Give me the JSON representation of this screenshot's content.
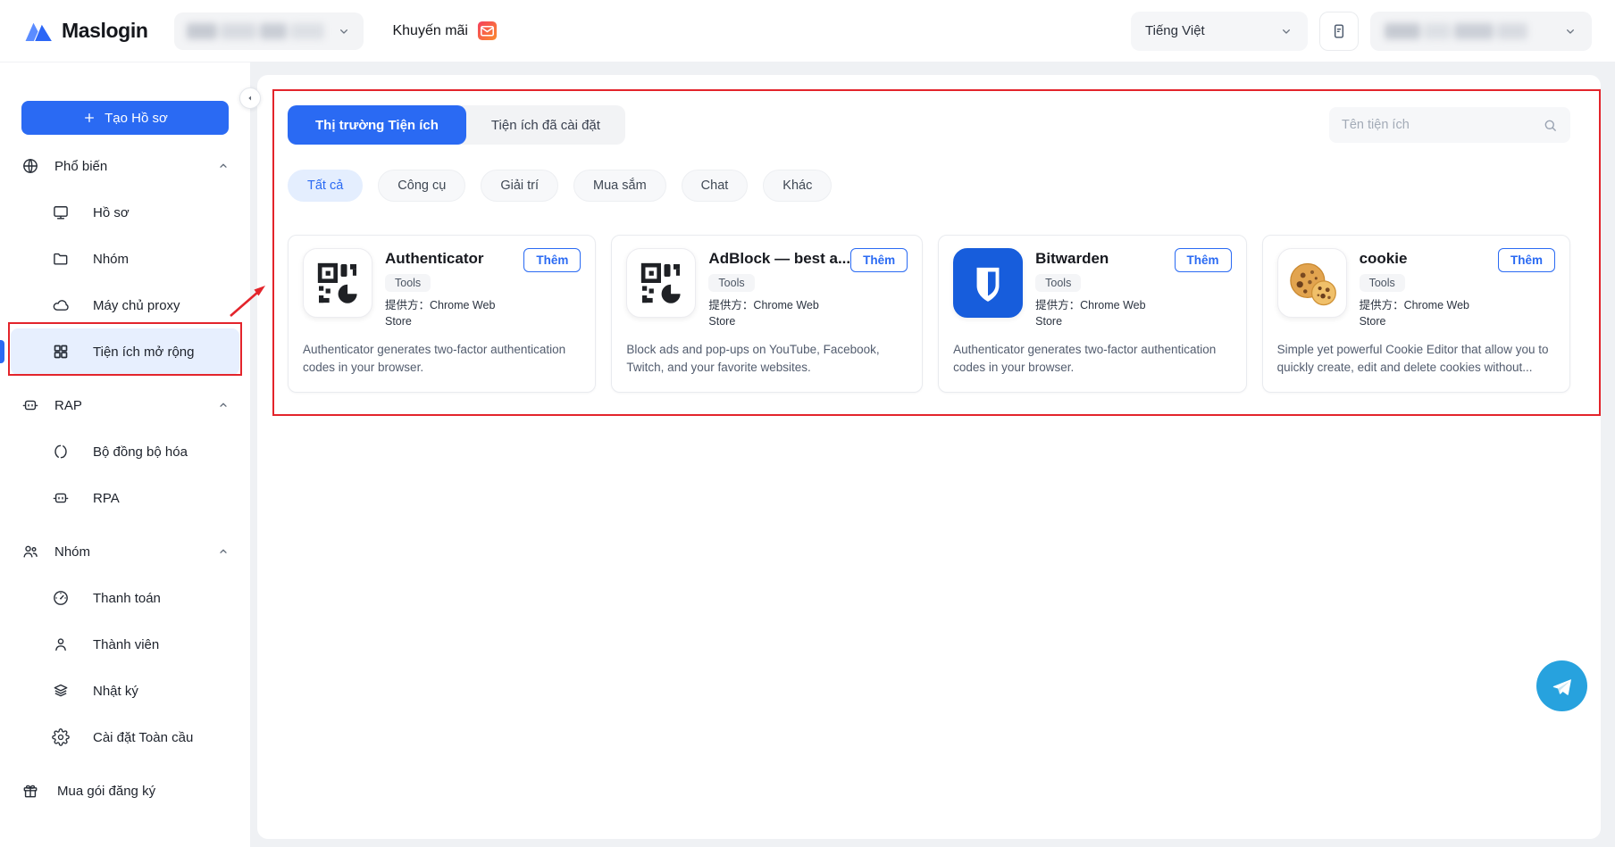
{
  "colors": {
    "accent_blue": "#2a6af3",
    "annotation_red": "#e3242b",
    "bitwarden_blue": "#175ddc",
    "telegram_blue": "#27a2de",
    "active_item_bg": "#e7effe"
  },
  "header": {
    "brand": "Maslogin",
    "workspace_selector": {
      "value": "",
      "blurred": true
    },
    "promo_label": "Khuyến mãi",
    "language_selector_value": "Tiếng Việt",
    "account_selector": {
      "value": "",
      "blurred": true
    }
  },
  "sidebar": {
    "create_profile_button": "Tạo Hồ sơ",
    "items": [
      {
        "label": "Phổ biến",
        "type": "section",
        "icon": "globe-icon",
        "collapsible": true
      },
      {
        "label": "Hồ sơ",
        "type": "child",
        "icon": "monitor-icon"
      },
      {
        "label": "Nhóm",
        "type": "child",
        "icon": "folder-icon"
      },
      {
        "label": "Máy chủ proxy",
        "type": "child",
        "icon": "cloud-icon"
      },
      {
        "label": "Tiện ích mở rộng",
        "type": "child",
        "icon": "grid-icon",
        "active": true
      },
      {
        "label": "RAP",
        "type": "section",
        "icon": "robot-icon",
        "collapsible": true
      },
      {
        "label": "Bộ đồng bộ hóa",
        "type": "child",
        "icon": "sync-icon"
      },
      {
        "label": "RPA",
        "type": "child",
        "icon": "robot-icon"
      },
      {
        "label": "Nhóm",
        "type": "section",
        "icon": "team-icon",
        "collapsible": true
      },
      {
        "label": "Thanh toán",
        "type": "child",
        "icon": "gauge-icon"
      },
      {
        "label": "Thành viên",
        "type": "child",
        "icon": "person-icon"
      },
      {
        "label": "Nhật ký",
        "type": "child",
        "icon": "layers-icon"
      },
      {
        "label": "Cài đặt Toàn cầu",
        "type": "child",
        "icon": "gear-icon"
      },
      {
        "label": "Mua gói đăng ký",
        "type": "top",
        "icon": "gift-icon"
      }
    ]
  },
  "main": {
    "tabs": [
      {
        "label": "Thị trường Tiện ích",
        "active": true
      },
      {
        "label": "Tiện ích đã cài đặt",
        "active": false
      }
    ],
    "search_placeholder": "Tên tiện ích",
    "filters": [
      {
        "label": "Tất cả",
        "active": true
      },
      {
        "label": "Công cụ",
        "active": false
      },
      {
        "label": "Giải trí",
        "active": false
      },
      {
        "label": "Mua sắm",
        "active": false
      },
      {
        "label": "Chat",
        "active": false
      },
      {
        "label": "Khác",
        "active": false
      }
    ],
    "add_button_label": "Thêm",
    "cards": [
      {
        "name": "Authenticator",
        "tag": "Tools",
        "provider": "提供方：Chrome Web Store",
        "icon": "qr-extension-icon",
        "description": "Authenticator generates two-factor authentication codes in your browser."
      },
      {
        "name": "AdBlock — best a...",
        "tag": "Tools",
        "provider": "提供方：Chrome Web Store",
        "icon": "qr-extension-icon",
        "description": "Block ads and pop-ups on YouTube, Facebook, Twitch, and your favorite websites."
      },
      {
        "name": "Bitwarden",
        "tag": "Tools",
        "provider": "提供方：Chrome Web Store",
        "icon": "bitwarden-shield-icon",
        "description": "Authenticator generates two-factor authentication codes in your browser."
      },
      {
        "name": "cookie",
        "tag": "Tools",
        "provider": "提供方：Chrome Web Store",
        "icon": "cookie-icon",
        "description": "Simple yet powerful Cookie Editor that allow you to quickly create, edit and delete cookies without..."
      }
    ]
  },
  "annotations": {
    "color": "#e3242b",
    "targets": [
      "extensions-panel",
      "sidebar-item-extensions"
    ]
  }
}
